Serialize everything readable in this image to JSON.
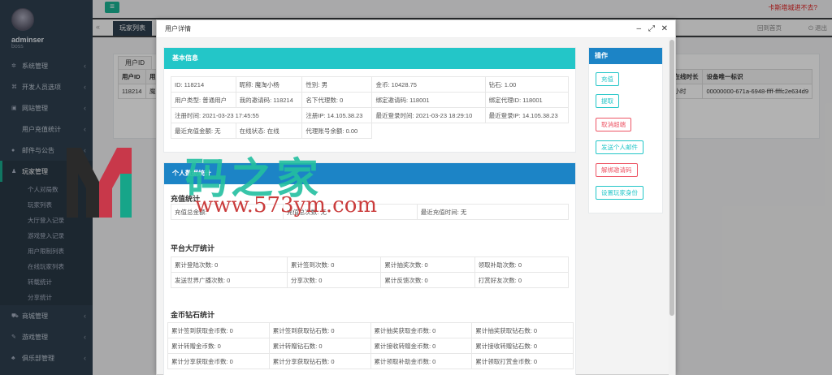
{
  "profile": {
    "username": "adminser",
    "role": "boss"
  },
  "header": {
    "top_right_link": "卡斯塔城进不去?"
  },
  "sidebar": {
    "items": [
      {
        "label": "系统管理",
        "icon": "gears-icon"
      },
      {
        "label": "开发人员选项",
        "icon": "code-icon"
      },
      {
        "label": "网站管理",
        "icon": "briefcase-icon"
      },
      {
        "label": "用户充值统计",
        "icon": "chart-icon"
      },
      {
        "label": "邮件与公告",
        "icon": "bell-icon"
      },
      {
        "label": "玩家管理",
        "icon": "user-icon"
      }
    ],
    "sub_items": [
      "个人对局数",
      "玩家列表",
      "大厅登入记录",
      "游戏登入记录",
      "用户限制列表",
      "在线玩家列表",
      "转载统计",
      "分享统计"
    ],
    "bottom_items": [
      {
        "label": "商城管理",
        "icon": "cart-icon"
      },
      {
        "label": "游戏管理",
        "icon": "gamepad-icon"
      },
      {
        "label": "俱乐部管理",
        "icon": "club-icon"
      }
    ]
  },
  "tabs": {
    "active": "玩家列表",
    "refresh": "回到首页",
    "logout": "退出"
  },
  "background": {
    "tab_label": "用户ID",
    "headers": [
      "用户ID",
      "用户",
      "在线时长",
      "设备唯一标识"
    ],
    "row": [
      "118214",
      "魔",
      "小时",
      "00000000-671a-6948-ffff-ffffc2e634d9"
    ]
  },
  "modal": {
    "title": "用户详情",
    "basic": {
      "heading": "基本信息",
      "rows": [
        [
          "ID: 118214",
          "昵称: 魔淘小杨",
          "性别: 男",
          "金币: 10428.75",
          "钻石: 1.00"
        ],
        [
          "用户类型: 普通用户",
          "我的邀请码: 118214",
          "名下代理数: 0",
          "绑定邀请码: 118001",
          "绑定代理ID: 118001"
        ],
        [
          "注册时间: 2021-03-23 17:45:55",
          "注册IP: 14.105.38.23",
          "最近登录时间: 2021-03-23 18:29:10",
          "最近登录IP: 14.105.38.23"
        ],
        [
          "最近充值金额: 无",
          "在线状态: 在线",
          "代理账号余额: 0.00"
        ]
      ]
    },
    "stats": {
      "heading": "个人数据统计",
      "recharge_title": "充值统计",
      "recharge_row": [
        "充值总金额: ",
        "充值总次数: 无",
        "最近充值时间: 无"
      ],
      "hall_title": "平台大厅统计",
      "hall_rows": [
        [
          "累计登陆次数: 0",
          "累计签到次数: 0",
          "累计抽奖次数: 0",
          "领取补助次数: 0"
        ],
        [
          "发送世界广播次数: 0",
          "分享次数: 0",
          "累计反馈次数: 0",
          "打赏好友次数: 0"
        ]
      ],
      "coin_title": "金币钻石统计",
      "coin_rows": [
        [
          "累计签到获取金币数: 0",
          "累计签到获取钻石数: 0",
          "累计抽奖获取金币数: 0",
          "累计抽奖获取钻石数: 0"
        ],
        [
          "累计转赠金币数: 0",
          "累计转赠钻石数: 0",
          "累计接收转赠金币数: 0",
          "累计接收转赠钻石数: 0"
        ],
        [
          "累计分享获取金币数: 0",
          "累计分享获取钻石数: 0",
          "累计领取补助金币数: 0",
          "累计领取打赏金币数: 0"
        ]
      ]
    },
    "actions": {
      "heading": "操作",
      "buttons": [
        {
          "label": "充值",
          "style": "cyan"
        },
        {
          "label": "提取",
          "style": "cyan"
        },
        {
          "label": "取消超端",
          "style": "red"
        },
        {
          "label": "发送个人邮件",
          "style": "cyan"
        },
        {
          "label": "解绑邀请码",
          "style": "red"
        },
        {
          "label": "设置玩家身份",
          "style": "cyan"
        }
      ]
    }
  },
  "watermark": {
    "line1": "码之家",
    "line2": "www.573ym.com"
  },
  "colors": {
    "sidebar": "#2f4050",
    "accent": "#1ab394",
    "cyan": "#23c6c8",
    "blue": "#1c84c6",
    "red": "#ed5565"
  }
}
